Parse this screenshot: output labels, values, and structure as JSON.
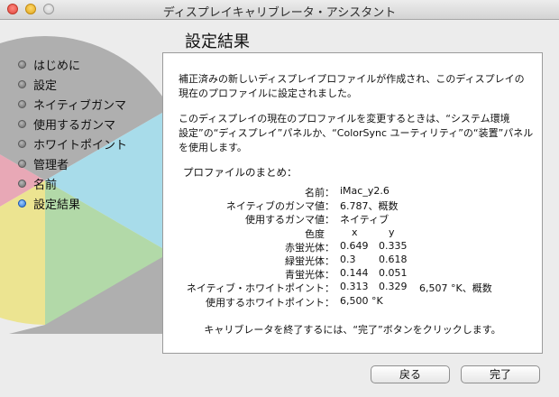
{
  "window": {
    "title": "ディスプレイキャリブレータ・アシスタント"
  },
  "page": {
    "title": "設定結果"
  },
  "steps": [
    {
      "label": "はじめに",
      "active": false
    },
    {
      "label": "設定",
      "active": false
    },
    {
      "label": "ネイティブガンマ",
      "active": false
    },
    {
      "label": "使用するガンマ",
      "active": false
    },
    {
      "label": "ホワイトポイント",
      "active": false
    },
    {
      "label": "管理者",
      "active": false
    },
    {
      "label": "名前",
      "active": false
    },
    {
      "label": "設定結果",
      "active": true
    }
  ],
  "panel": {
    "paragraph1_line1": "補正済みの新しいディスプレイプロファイルが作成され、このディスプレイの",
    "paragraph1_line2": "現在のプロファイルに設定されました。",
    "paragraph2_line1": "このディスプレイの現在のプロファイルを変更するときは、“システム環境",
    "paragraph2_line2": "設定”の“ディスプレイ”パネルか、“ColorSync ユーティリティ”の“装置”パネル",
    "paragraph2_line3": "を使用します。",
    "summary_heading": "プロファイルのまとめ：",
    "name_label": "名前：",
    "name_value": "iMac_y2.6",
    "native_gamma_label": "ネイティブのガンマ値：",
    "native_gamma_value": "6.787、概数",
    "target_gamma_label": "使用するガンマ値：",
    "target_gamma_value": "ネイティブ",
    "chroma_header": "色度",
    "x_header": "x",
    "y_header": "y",
    "red_label": "赤蛍光体：",
    "red_x": "0.649",
    "red_y": "0.335",
    "green_label": "緑蛍光体：",
    "green_x": "0.3",
    "green_y": "0.618",
    "blue_label": "青蛍光体：",
    "blue_x": "0.144",
    "blue_y": "0.051",
    "native_white_label": "ネイティブ・ホワイトポイント：",
    "native_white_x": "0.313",
    "native_white_y": "0.329",
    "native_white_temp": "6,507 °K、概数",
    "target_white_label": "使用するホワイトポイント：",
    "target_white_value": "6,500 °K",
    "end_instruction": "キャリブレータを終了するには、“完了”ボタンをクリックします。"
  },
  "buttons": {
    "back": "戻る",
    "done": "完了"
  },
  "colors": {
    "active_step": "#2a6fd6"
  }
}
